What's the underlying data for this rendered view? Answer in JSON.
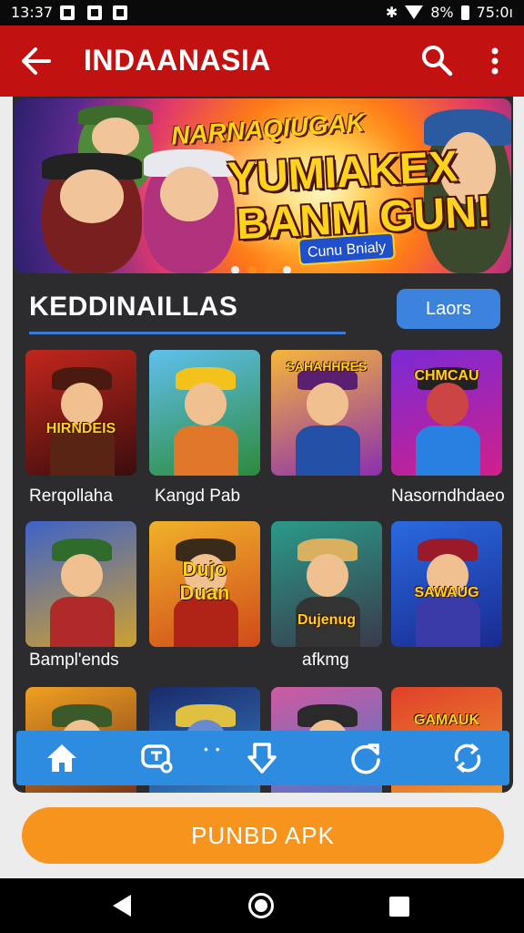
{
  "status_bar": {
    "time": "13:37",
    "battery": "8%",
    "clock_right": "75:0ı"
  },
  "app_bar": {
    "title": "INDAANASIA"
  },
  "banner": {
    "line1": "NARNAQIUGAK",
    "line2": "YUMIAKEX",
    "line3": "BANM GUN!",
    "badge": "Cunu Bnialy",
    "active_dot": 1
  },
  "section": {
    "title": "KEDDINAILLAS",
    "button": "Laors"
  },
  "games": [
    {
      "tile_text": "HIRNDEIS",
      "label": "Rerqollaha"
    },
    {
      "tile_text": "",
      "label": "Kangd Pab"
    },
    {
      "tile_text": "SAHAHHRES",
      "label": ""
    },
    {
      "tile_text": "CHMCAU",
      "label": "Nasorndhdaeo"
    },
    {
      "tile_text": "",
      "label": "Bampl'ends"
    },
    {
      "tile_text": "Dujo Duan",
      "label": ""
    },
    {
      "tile_text": "Dujenug",
      "label": "afkmg"
    },
    {
      "tile_text": "SAWAUG",
      "label": ""
    },
    {
      "tile_text": "",
      "label": ""
    },
    {
      "tile_text": "",
      "label": ""
    },
    {
      "tile_text": "",
      "label": ""
    },
    {
      "tile_text": "GAMAUK",
      "label": ""
    }
  ],
  "bottom_nav": {
    "items": [
      "home-icon",
      "chat-icon",
      "download-icon",
      "refresh-icon",
      "sync-icon"
    ],
    "active_color": "#ffffff"
  },
  "cta": {
    "label": "PUNBD APK"
  },
  "colors": {
    "app_bar": "#c21111",
    "card": "#2c2c2f",
    "accent": "#3b83dd",
    "cta": "#f7941d"
  }
}
